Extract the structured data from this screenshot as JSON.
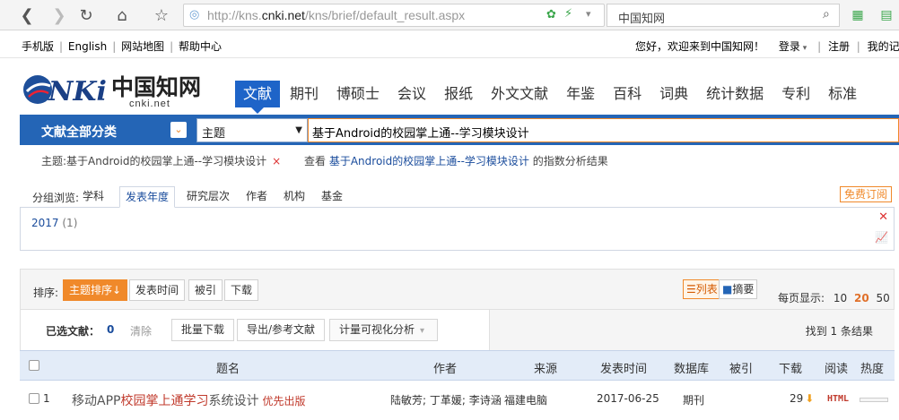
{
  "browser": {
    "url_prefix": "http://kns.",
    "url_domain": "cnki.net",
    "url_suffix": "/kns/brief/default_result.aspx",
    "search_box": "中国知网"
  },
  "topbar": {
    "left_links": [
      "手机版",
      "English",
      "网站地图",
      "帮助中心"
    ],
    "welcome": "您好，欢迎来到中国知网！",
    "login": "登录",
    "register": "注册",
    "my_records": "我的记录"
  },
  "logo": {
    "main": "CNKi中国知网",
    "sub": "cnki.net"
  },
  "nav": {
    "tabs": [
      "文献",
      "期刊",
      "博硕士",
      "会议",
      "报纸",
      "外文文献",
      "年鉴",
      "百科",
      "词典",
      "统计数据",
      "专利",
      "标准"
    ],
    "active": "文献"
  },
  "query": {
    "category_label": "文献全部分类",
    "field": "主题",
    "keyword": "基于Android的校园掌上通--学习模块设计"
  },
  "history": {
    "item": "主题:基于Android的校园掌上通--学习模块设计",
    "view_prefix": "查看",
    "view_link": "基于Android的校园掌上通--学习模块设计",
    "view_suffix": "的指数分析结果"
  },
  "grouping": {
    "label": "分组浏览:",
    "tabs": [
      "学科",
      "发表年度",
      "研究层次",
      "作者",
      "机构",
      "基金"
    ],
    "active": "发表年度",
    "free_subscribe": "免费订阅",
    "year": "2017",
    "year_count": "(1)"
  },
  "sort": {
    "label": "排序:",
    "options": [
      "主题排序↓",
      "发表时间",
      "被引",
      "下载"
    ],
    "view_list": "列表",
    "view_abstract": "摘要",
    "per_page_label": "每页显示:",
    "per_page_options": [
      "10",
      "20",
      "50"
    ],
    "per_page_active": "20"
  },
  "selection": {
    "selected_label": "已选文献：",
    "selected_count": "0",
    "clear": "清除",
    "actions": [
      "批量下载",
      "导出/参考文献",
      "计量可视化分析"
    ],
    "found": "找到 1 条结果"
  },
  "table": {
    "headers": [
      "题名",
      "作者",
      "来源",
      "发表时间",
      "数据库",
      "被引",
      "下载",
      "阅读",
      "热度"
    ],
    "rows": [
      {
        "num": "1",
        "title_pre": "移动APP",
        "title_hl": "校园掌上通学习",
        "title_post": "系统设计",
        "badge": "优先出版",
        "authors": "陆敏芳; 丁革媛; 李诗涵",
        "source": "福建电脑",
        "date": "2017-06-25",
        "db": "期刊",
        "cited": "",
        "downloads": "29",
        "read": "HTML"
      }
    ]
  }
}
